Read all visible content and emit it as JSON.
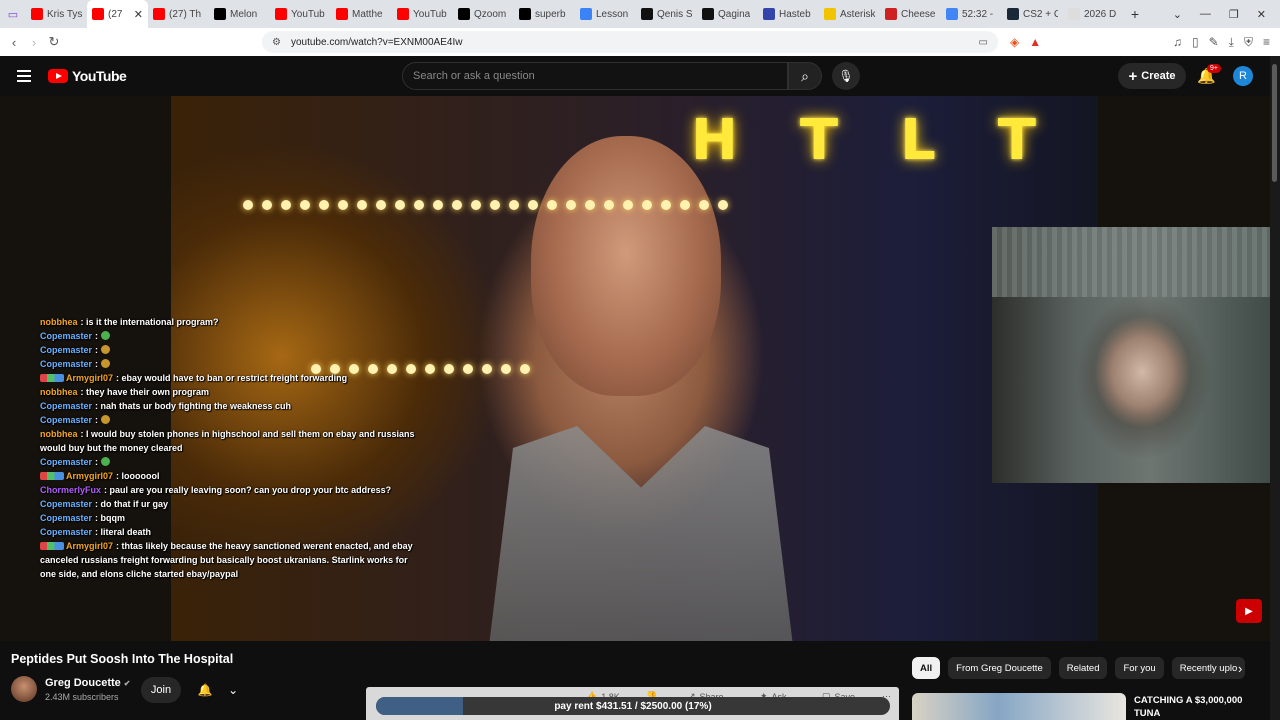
{
  "browser": {
    "tabs": [
      {
        "label": "Kris Tys",
        "color": "#ff0000"
      },
      {
        "label": "(27",
        "color": "#ff0000",
        "active": true
      },
      {
        "label": "(27) Th",
        "color": "#ff0000"
      },
      {
        "label": "Melon",
        "color": "#000000"
      },
      {
        "label": "YouTub",
        "color": "#ff0000"
      },
      {
        "label": "Matthe",
        "color": "#ff0000"
      },
      {
        "label": "YouTub",
        "color": "#ff0000"
      },
      {
        "label": "Qzoom",
        "color": "#000000"
      },
      {
        "label": "superb",
        "color": "#000000"
      },
      {
        "label": "Lesson",
        "color": "#3b82f6"
      },
      {
        "label": "Qenis S",
        "color": "#111111"
      },
      {
        "label": "Qagina",
        "color": "#111111"
      },
      {
        "label": "Hasteb",
        "color": "#3344aa"
      },
      {
        "label": "Asterisk",
        "color": "#f2c400"
      },
      {
        "label": "Cheese",
        "color": "#cc2222"
      },
      {
        "label": "52:32 -",
        "color": "#4285f4"
      },
      {
        "label": "CS2 + C",
        "color": "#1b2838"
      },
      {
        "label": "2026 D",
        "color": "#dddddd"
      }
    ],
    "url": "youtube.com/watch?v=EXNM00AE4Iw"
  },
  "header": {
    "logo_text": "YouTube",
    "search_placeholder": "Search or ask a question",
    "create_label": "Create",
    "notif_badge": "9+",
    "avatar_letter": "R"
  },
  "chat": [
    {
      "user": "nobbhea",
      "color": "#f5a623",
      "text": "is it the international program?"
    },
    {
      "user": "Copemaster",
      "color": "#6ab0ff",
      "text": "",
      "emote": "#4caf50"
    },
    {
      "user": "Copemaster",
      "color": "#6ab0ff",
      "text": "",
      "emote": "#c8962e"
    },
    {
      "user": "Copemaster",
      "color": "#6ab0ff",
      "text": "",
      "emote": "#c8962e"
    },
    {
      "user": "Armygirl07",
      "color": "#f5a623",
      "badges": true,
      "text": "ebay would have to ban or restrict freight forwarding"
    },
    {
      "user": "nobbhea",
      "color": "#f5a623",
      "text": "they have their own program"
    },
    {
      "user": "Copemaster",
      "color": "#6ab0ff",
      "text": "nah thats ur body fighting the weakness cuh"
    },
    {
      "user": "Copemaster",
      "color": "#6ab0ff",
      "text": "",
      "emote": "#c8962e"
    },
    {
      "user": "nobbhea",
      "color": "#f5a623",
      "text": "I would buy stolen phones in highschool and sell them on ebay and russians would buy but the money cleared"
    },
    {
      "user": "Copemaster",
      "color": "#6ab0ff",
      "text": "",
      "emote": "#4caf50"
    },
    {
      "user": "Armygirl07",
      "color": "#f5a623",
      "badges": true,
      "text": "looooool"
    },
    {
      "user": "ChormerlyFux",
      "color": "#b05cff",
      "text": "paul are you really leaving soon? can you drop your btc address?"
    },
    {
      "user": "Copemaster",
      "color": "#6ab0ff",
      "text": "do that if ur gay"
    },
    {
      "user": "Copemaster",
      "color": "#6ab0ff",
      "text": "bqqm"
    },
    {
      "user": "Copemaster",
      "color": "#6ab0ff",
      "text": "literal death"
    },
    {
      "user": "Armygirl07",
      "color": "#f5a623",
      "badges": true,
      "text": "thtas likely because the heavy sanctioned werent enacted, and ebay canceled russians freight forwarding but basically boost ukranians. Starlink works for one side, and elons cliche started ebay/paypal"
    }
  ],
  "video": {
    "sign_letters": [
      "H",
      "T",
      "L",
      "T"
    ]
  },
  "meta": {
    "title": "Peptides Put Soosh Into The Hospital",
    "channel": "Greg Doucette",
    "subscribers": "2.43M subscribers",
    "join_label": "Join",
    "likes": "1.8K",
    "share_label": "Share",
    "ask_label": "Ask",
    "save_label": "Save"
  },
  "rent_bar": {
    "text": "pay rent $431.51 / $2500.00 (17%)",
    "progress": 0.17
  },
  "chips": [
    "All",
    "From Greg Doucette",
    "Related",
    "For you",
    "Recently uplo"
  ],
  "recommendation": {
    "title": "CATCHING A $3,000,000 TUNA"
  }
}
